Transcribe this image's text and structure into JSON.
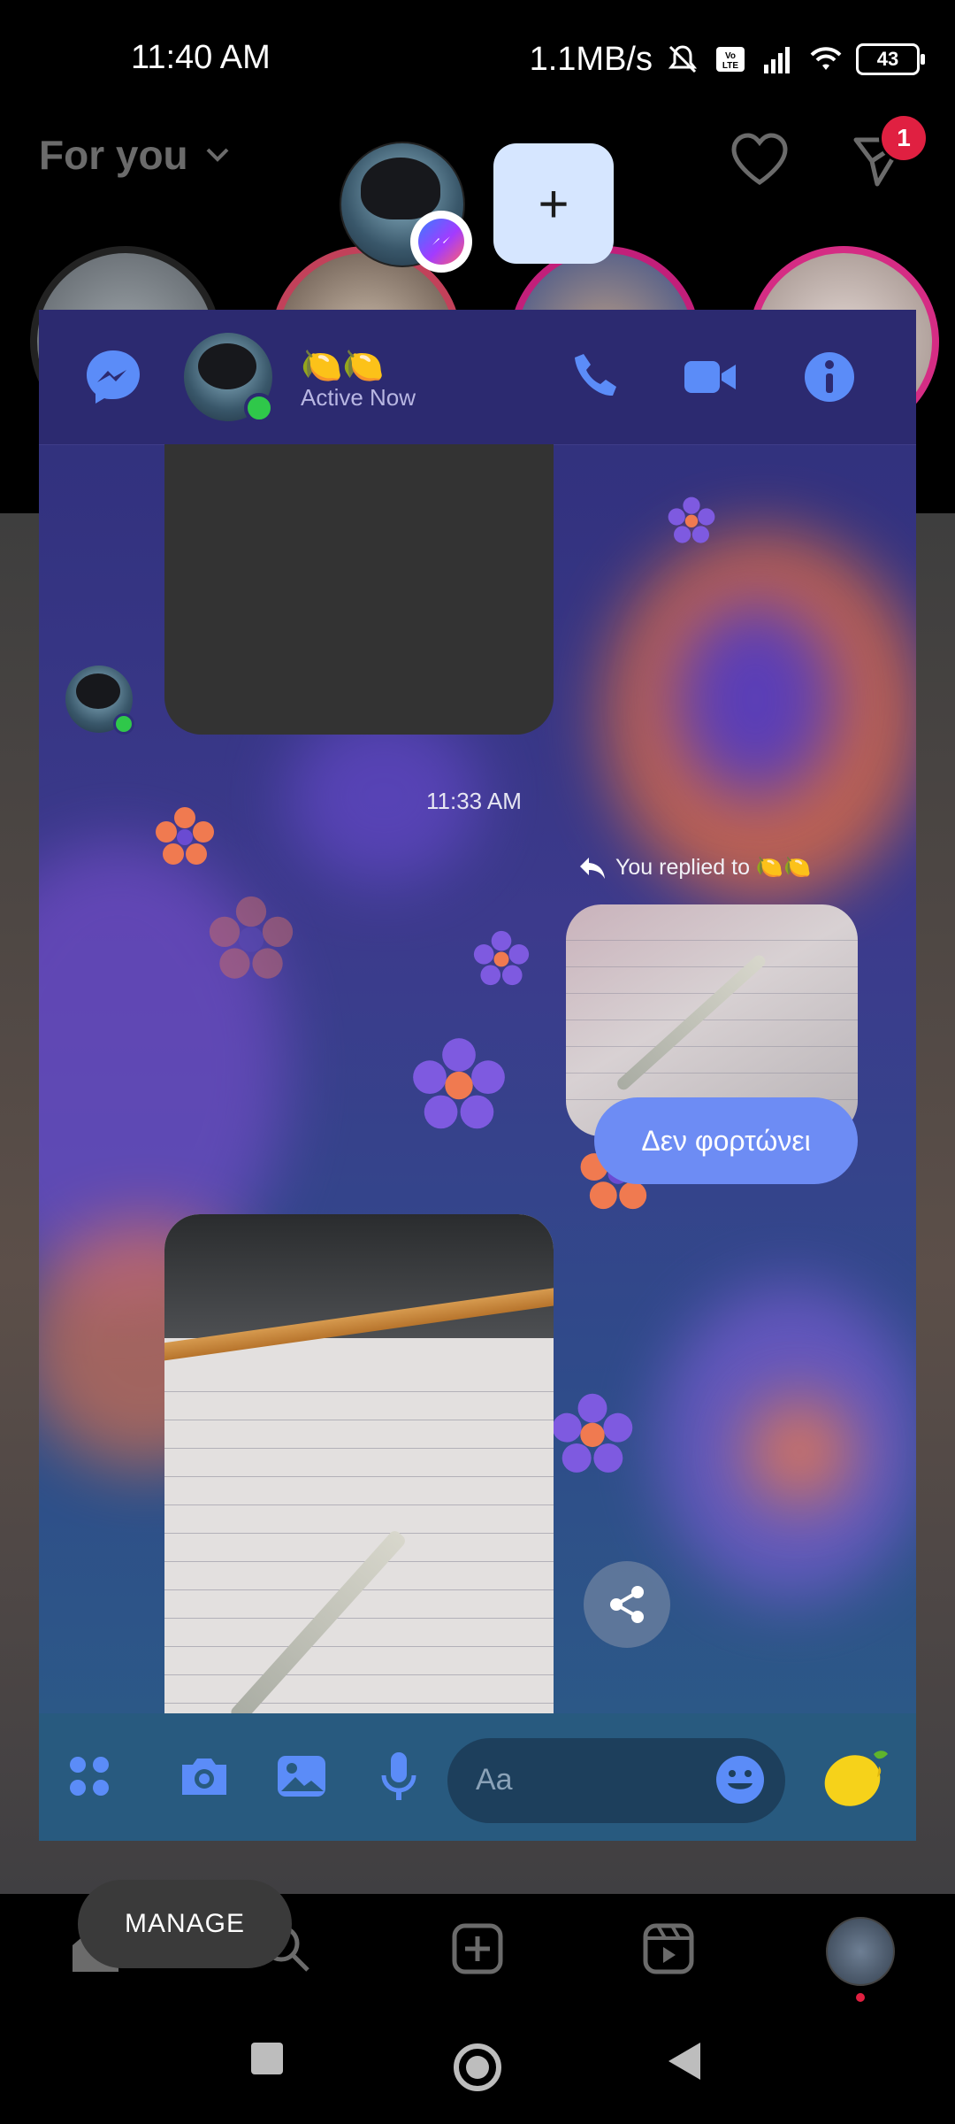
{
  "status_bar": {
    "time": "11:40 AM",
    "speed": "1.1MB/s",
    "battery": "43",
    "icons": [
      "mute-icon",
      "volte-icon",
      "signal-icon",
      "wifi-icon",
      "battery-icon"
    ]
  },
  "instagram": {
    "feed_title": "For you",
    "notification_count": "1",
    "nav": [
      "home-icon",
      "search-icon",
      "create-icon",
      "reels-icon",
      "profile-icon"
    ]
  },
  "chat_heads": {
    "add_label": "+"
  },
  "messenger": {
    "contact_name": "🍋🍋",
    "contact_status": "Active Now",
    "timestamp": "11:33 AM",
    "replied_label": "You replied to 🍋🍋",
    "message_text": "Δεν φορτώνει",
    "input_placeholder": "Aa",
    "quick_reaction": "🍋",
    "accent_color": "#6d8cf4",
    "icon_color": "#5b8cf8"
  },
  "manage_label": "MANAGE"
}
